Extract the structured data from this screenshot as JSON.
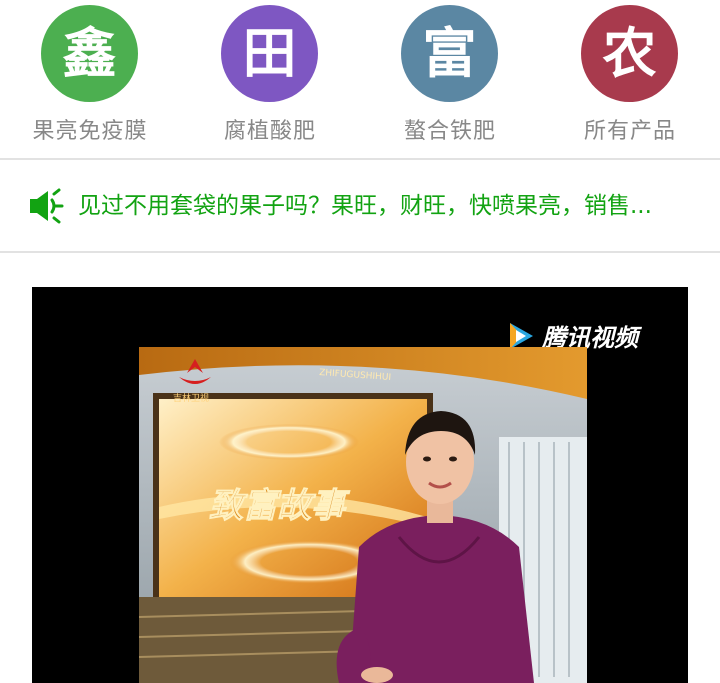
{
  "nav": {
    "items": [
      {
        "glyph": "鑫",
        "label": "果亮免疫膜",
        "color": "#4caf50"
      },
      {
        "glyph": "田",
        "label": "腐植酸肥",
        "color": "#7e57c2"
      },
      {
        "glyph": "富",
        "label": "螯合铁肥",
        "color": "#5b87a3"
      },
      {
        "glyph": "农",
        "label": "所有产品",
        "color": "#a83a4d"
      }
    ]
  },
  "notice": {
    "icon": "speaker-icon",
    "text": "见过不用套袋的果子吗？果旺，财旺，快喷果亮，销售..."
  },
  "video": {
    "watermark": "腾讯视频",
    "studio_text": "ZHIFUGUSHIHUI",
    "screen_title": "致富故事",
    "channel_logo_text": "吉林卫视"
  }
}
